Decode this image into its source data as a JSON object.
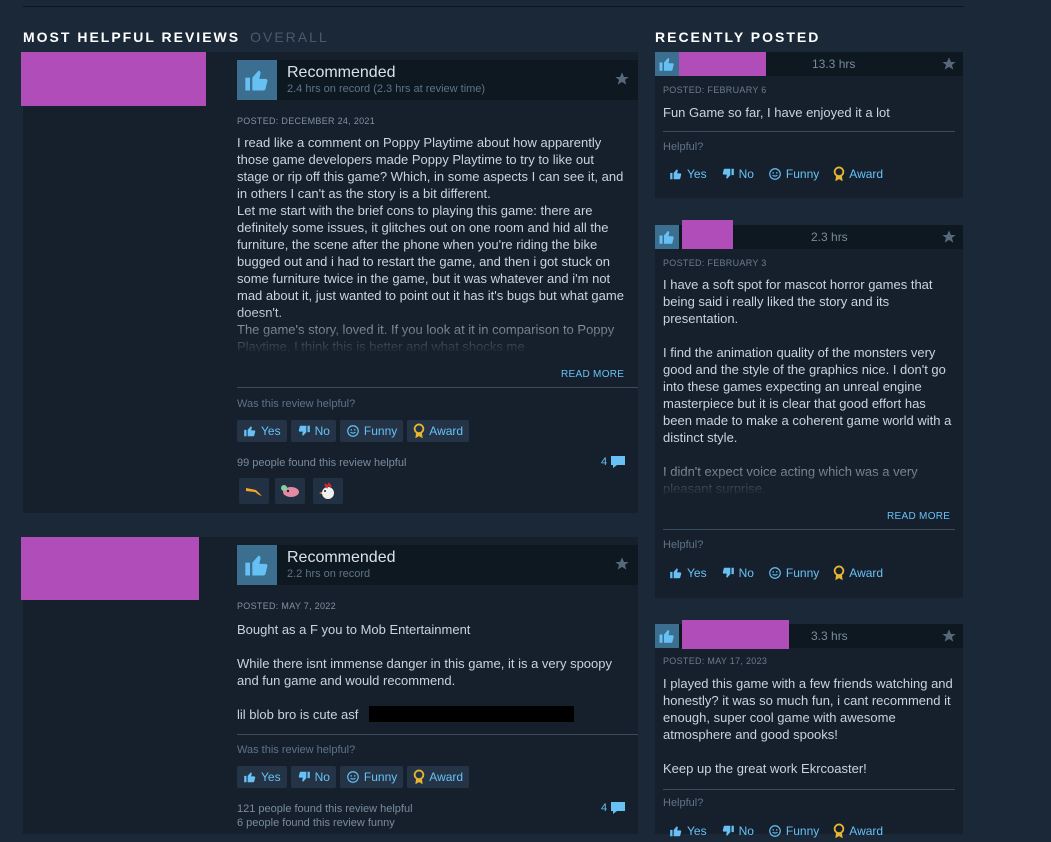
{
  "left_section": {
    "title": "MOST HELPFUL REVIEWS",
    "subtitle": "OVERALL"
  },
  "right_section": {
    "title": "RECENTLY POSTED"
  },
  "buttons": {
    "yes": "Yes",
    "no": "No",
    "funny": "Funny",
    "award": "Award",
    "read_more": "READ MORE"
  },
  "colors": {
    "background": "#1b2838",
    "card": "#16202d",
    "accent": "#67c1f5",
    "redaction": "#b04db8"
  },
  "reviews": [
    {
      "rating": "Recommended",
      "hours": "2.4 hrs on record (2.3 hrs at review time)",
      "posted": "POSTED: DECEMBER 24, 2021",
      "body": "I read like a comment on Poppy Playtime about how apparently those game developers made Poppy Playtime to try to like out stage or rip off this game? Which, in some aspects I can see it, and in others I can't as the story is a bit different.\nLet me start with the brief cons to playing this game: there are definitely some issues, it glitches out on one room and hid all the furniture, the scene after the phone when you're riding the bike bugged out and i had to restart the game, and then i got stuck on some furniture twice in the game, but it was whatever and i'm not mad about it, just wanted to point out it has it's bugs but what game doesn't.\nThe game's story, loved it. If you look at it in comparison to Poppy Playtime, I think this is better and what shocks me",
      "helpful_question": "Was this review helpful?",
      "helpful_count": "99 people found this review helpful",
      "comments": "4",
      "award_icons": [
        "orange-boomerang-icon",
        "pink-blob-icon",
        "chicken-icon"
      ]
    },
    {
      "rating": "Recommended",
      "hours": "2.2 hrs on record",
      "posted": "POSTED: MAY 7, 2022",
      "body": "Bought as a F you to Mob Entertainment\n\nWhile there isnt immense danger in this game, it is a very spoopy and fun game and would recommend.\n\nlil blob bro is cute asf",
      "helpful_question": "Was this review helpful?",
      "helpful_count": "121 people found this review helpful",
      "funny_count": "6 people found this review funny",
      "comments": "4"
    }
  ],
  "recent": [
    {
      "hours": "13.3 hrs",
      "posted": "POSTED: FEBRUARY 6",
      "body": "Fun Game so far, I have enjoyed it a lot",
      "helpful_question": "Helpful?"
    },
    {
      "hours": "2.3 hrs",
      "posted": "POSTED: FEBRUARY 3",
      "body": "I have a soft spot for mascot horror games that being said i really liked the story and its presentation.\n\nI find the animation quality of the monsters very good and the style of the graphics nice. I don't go into these games expecting an unreal engine masterpiece but it is clear that good effort has been made to make a coherent game world with a distinct style.\n\nI didn't expect voice acting which was a very pleasant surprise.",
      "helpful_question": "Helpful?"
    },
    {
      "hours": "3.3 hrs",
      "posted": "POSTED: MAY 17, 2023",
      "body": "I played this game with a few friends watching and honestly? it was so much fun, i cant recommend it enough, super cool game with awesome atmosphere and good spooks!\n\nKeep up the great work Ekrcoaster!",
      "helpful_question": "Helpful?"
    }
  ]
}
